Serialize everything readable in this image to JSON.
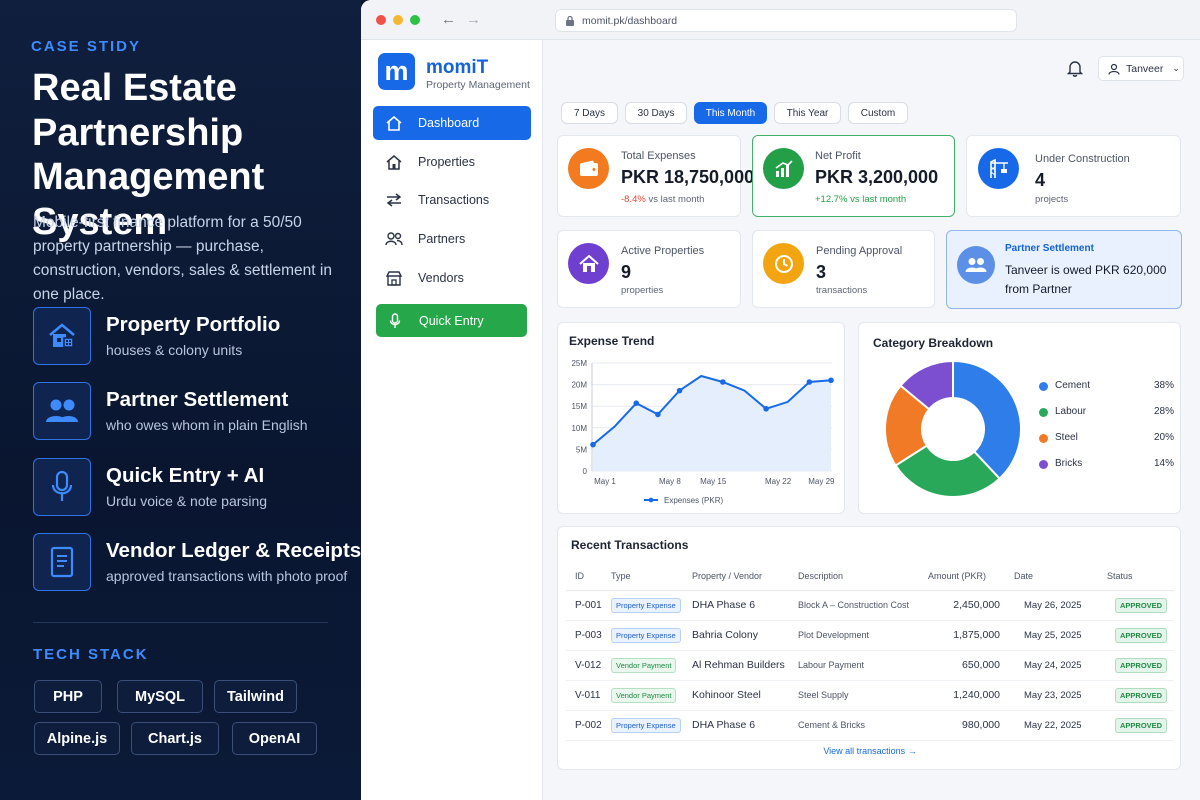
{
  "left": {
    "label": "CASE STIDY",
    "title": "Real Estate Partnership Management System",
    "description": "Mobile-first finance platform for a 50/50 property partnership — purchase, construction, vendors, sales & settlement in one place.",
    "features": [
      {
        "title": "Property Portfolio",
        "subtitle": "houses & colony units",
        "icon": "house-icon"
      },
      {
        "title": "Partner Settlement",
        "subtitle": "who owes whom in plain English",
        "icon": "people-icon"
      },
      {
        "title": "Quick Entry + AI",
        "subtitle": "Urdu voice & note parsing",
        "icon": "microphone-icon"
      },
      {
        "title": "Vendor Ledger & Receipts",
        "subtitle": "approved transactions with photo proof",
        "icon": "document-icon"
      }
    ],
    "tech_label": "TECH STACK",
    "tech": [
      "PHP",
      "MySQL",
      "Tailwind",
      "Alpine.js",
      "Chart.js",
      "OpenAI"
    ]
  },
  "browser": {
    "url": "momit.pk/dashboard"
  },
  "sidebar": {
    "logo_letter": "m",
    "brand": "momiT",
    "brand_sub": "Property Management",
    "items": [
      {
        "label": "Dashboard",
        "icon": "home-icon"
      },
      {
        "label": "Properties",
        "icon": "house-icon"
      },
      {
        "label": "Transactions",
        "icon": "swap-arrows-icon"
      },
      {
        "label": "Partners",
        "icon": "people-icon"
      },
      {
        "label": "Vendors",
        "icon": "store-icon"
      },
      {
        "label": "Quick Entry",
        "icon": "microphone-icon"
      }
    ]
  },
  "topbar": {
    "user": "Tanveer"
  },
  "filters": [
    "7 Days",
    "30 Days",
    "This Month",
    "This Year",
    "Custom"
  ],
  "kpis": {
    "total_expenses": {
      "label": "Total Expenses",
      "value": "PKR 18,750,000",
      "change": "-8.4%",
      "change_suffix": "vs last month",
      "color": "#f47a1f"
    },
    "net_profit": {
      "label": "Net Profit",
      "value": "PKR 3,200,000",
      "change": "+12.7%",
      "change_suffix": "vs last month",
      "color": "#23a047"
    },
    "under_construction": {
      "label": "Under Construction",
      "value": "4",
      "unit": "projects",
      "color": "#1769e8"
    },
    "active_properties": {
      "label": "Active Properties",
      "value": "9",
      "unit": "properties",
      "color": "#6f3fd0"
    },
    "pending_approval": {
      "label": "Pending Approval",
      "value": "3",
      "unit": "transactions",
      "color": "#f2a511"
    },
    "settlement": {
      "label": "Partner Settlement",
      "line1": "Tanveer is owed PKR 620,000",
      "line2": "from Partner",
      "color": "#5c8fe6"
    }
  },
  "chart_data": [
    {
      "type": "line",
      "title": "Expense Trend",
      "x": [
        "May 1",
        "May 4",
        "May 6",
        "May 8",
        "May 11",
        "May 15",
        "May 18",
        "May 20",
        "May 22",
        "May 26",
        "May 29",
        "May 31"
      ],
      "tick_labels": [
        "May 1",
        "May 8",
        "May 15",
        "May 22",
        "May 29"
      ],
      "series": [
        {
          "name": "Expenses (PKR)",
          "values": [
            6.1,
            10.3,
            15.7,
            13.1,
            18.6,
            22.0,
            20.6,
            18.6,
            14.4,
            16.0,
            20.6,
            21.0
          ]
        }
      ],
      "yticks": [
        "0",
        "5M",
        "10M",
        "15M",
        "20M",
        "25M"
      ],
      "ylim": [
        0,
        25
      ],
      "color": "#1769e8"
    },
    {
      "type": "pie",
      "title": "Category Breakdown",
      "categories": [
        "Cement",
        "Labour",
        "Steel",
        "Bricks"
      ],
      "values": [
        38,
        28,
        20,
        14
      ],
      "labels": [
        "38%",
        "28%",
        "20%",
        "14%"
      ],
      "colors": [
        "#2f7de8",
        "#2aa85a",
        "#f07a26",
        "#7b4fd0"
      ]
    }
  ],
  "transactions": {
    "title": "Recent Transactions",
    "headers": [
      "ID",
      "Type",
      "Property / Vendor",
      "Description",
      "Amount (PKR)",
      "Date",
      "Status"
    ],
    "rows": [
      {
        "id": "P-001",
        "type": "Property Expense",
        "kind": "pe",
        "party": "DHA Phase 6",
        "desc": "Block A – Construction Cost",
        "amount": "2,450,000",
        "date": "May 26, 2025",
        "status": "APPROVED"
      },
      {
        "id": "P-003",
        "type": "Property Expense",
        "kind": "pe",
        "party": "Bahria Colony",
        "desc": "Plot Development",
        "amount": "1,875,000",
        "date": "May 25, 2025",
        "status": "APPROVED"
      },
      {
        "id": "V-012",
        "type": "Vendor Payment",
        "kind": "vp",
        "party": "Al Rehman Builders",
        "desc": "Labour Payment",
        "amount": "650,000",
        "date": "May 24, 2025",
        "status": "APPROVED"
      },
      {
        "id": "V-011",
        "type": "Vendor Payment",
        "kind": "vp",
        "party": "Kohinoor Steel",
        "desc": "Steel Supply",
        "amount": "1,240,000",
        "date": "May 23, 2025",
        "status": "APPROVED"
      },
      {
        "id": "P-002",
        "type": "Property Expense",
        "kind": "pe",
        "party": "DHA Phase 6",
        "desc": "Cement & Bricks",
        "amount": "980,000",
        "date": "May 22, 2025",
        "status": "APPROVED"
      }
    ],
    "view_all": "View all transactions →"
  }
}
